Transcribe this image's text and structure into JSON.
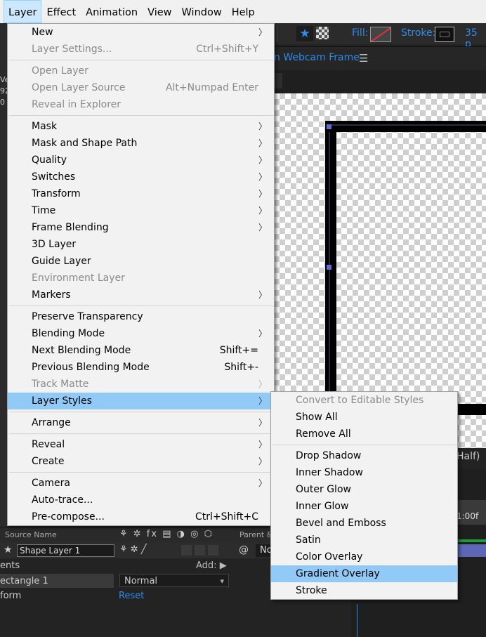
{
  "menubar": {
    "items": [
      {
        "label": "Layer",
        "active": true
      },
      {
        "label": "Effect"
      },
      {
        "label": "Animation"
      },
      {
        "label": "View"
      },
      {
        "label": "Window"
      },
      {
        "label": "Help"
      }
    ]
  },
  "toolbar": {
    "fill_label": "Fill:",
    "stroke_label": "Stroke:",
    "stroke_width": "35 p"
  },
  "comp_panel": {
    "title": "n Webcam Frame",
    "magnification": "Half)"
  },
  "left_strip": {
    "lines": [
      "Ve",
      "92",
      "0"
    ]
  },
  "timeline": {
    "source_name_header": "Source Name",
    "parent_header": "Parent &",
    "time_marker": "1:00f",
    "layer_name": "Shape Layer 1",
    "parent_value": "No",
    "contents_label": "ents",
    "add_label": "Add:",
    "rectangle_label": "ectangle 1",
    "blend_mode": "Normal",
    "transform_label": "form",
    "reset_label": "Reset"
  },
  "layer_menu": {
    "new": {
      "label": "New"
    },
    "layer_settings": {
      "label": "Layer Settings...",
      "shortcut": "Ctrl+Shift+Y"
    },
    "open_layer": {
      "label": "Open Layer"
    },
    "open_layer_source": {
      "label": "Open Layer Source",
      "shortcut": "Alt+Numpad Enter"
    },
    "reveal_in_explorer": {
      "label": "Reveal in Explorer"
    },
    "mask": {
      "label": "Mask"
    },
    "mask_and_shape_path": {
      "label": "Mask and Shape Path"
    },
    "quality": {
      "label": "Quality"
    },
    "switches": {
      "label": "Switches"
    },
    "transform": {
      "label": "Transform"
    },
    "time": {
      "label": "Time"
    },
    "frame_blending": {
      "label": "Frame Blending"
    },
    "layer_3d": {
      "label": "3D Layer"
    },
    "guide_layer": {
      "label": "Guide Layer"
    },
    "environment_layer": {
      "label": "Environment Layer"
    },
    "markers": {
      "label": "Markers"
    },
    "preserve_transparency": {
      "label": "Preserve Transparency"
    },
    "blending_mode": {
      "label": "Blending Mode"
    },
    "next_blending_mode": {
      "label": "Next Blending Mode",
      "shortcut": "Shift+="
    },
    "previous_blending_mode": {
      "label": "Previous Blending Mode",
      "shortcut": "Shift+-"
    },
    "track_matte": {
      "label": "Track Matte"
    },
    "layer_styles": {
      "label": "Layer Styles"
    },
    "arrange": {
      "label": "Arrange"
    },
    "reveal": {
      "label": "Reveal"
    },
    "create": {
      "label": "Create"
    },
    "camera": {
      "label": "Camera"
    },
    "auto_trace": {
      "label": "Auto-trace..."
    },
    "pre_compose": {
      "label": "Pre-compose...",
      "shortcut": "Ctrl+Shift+C"
    }
  },
  "styles_menu": {
    "convert": {
      "label": "Convert to Editable Styles"
    },
    "show_all": {
      "label": "Show All"
    },
    "remove_all": {
      "label": "Remove All"
    },
    "drop_shadow": {
      "label": "Drop Shadow"
    },
    "inner_shadow": {
      "label": "Inner Shadow"
    },
    "outer_glow": {
      "label": "Outer Glow"
    },
    "inner_glow": {
      "label": "Inner Glow"
    },
    "bevel_emboss": {
      "label": "Bevel and Emboss"
    },
    "satin": {
      "label": "Satin"
    },
    "color_overlay": {
      "label": "Color Overlay"
    },
    "gradient_overlay": {
      "label": "Gradient Overlay"
    },
    "stroke": {
      "label": "Stroke"
    }
  },
  "colors": {
    "accent": "#2d8ceb",
    "menu_highlight": "#91c9f7",
    "menubar_active": "#cce8ff",
    "disabled_text": "#8a8a8a"
  }
}
